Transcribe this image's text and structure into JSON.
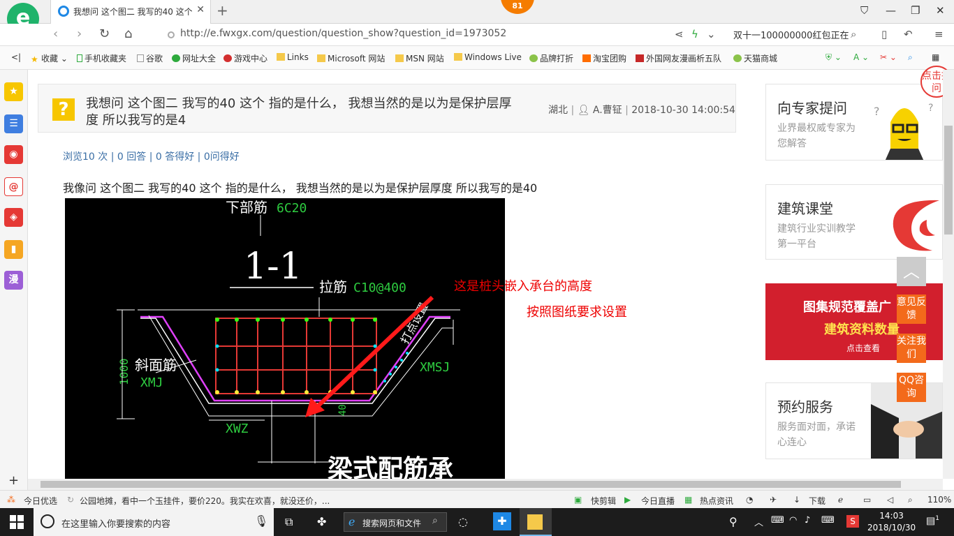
{
  "browser": {
    "tab_title": "我想问 这个图二 我写的40 这个 指的是什么",
    "badge": "81",
    "url": "http://e.fwxgx.com/question/question_show?question_id=1973052",
    "search_text": "双十一100000000红包正在"
  },
  "bookmarks": [
    "收藏",
    "手机收藏夹",
    "谷歌",
    "网址大全",
    "游戏中心",
    "Links",
    "Microsoft 网站",
    "MSN 网站",
    "Windows Live",
    "品牌打折",
    "淘宝团购",
    "外国网友漫画析五队",
    "天猫商城"
  ],
  "sidebar": {
    "comic_label": "漫"
  },
  "question": {
    "icon": "?",
    "title": "我想问 这个图二 我写的40 这个 指的是什么， 我想当然的是以为是保护层厚度 所以我写的是4",
    "location": "湖北",
    "author": "A.曹钲",
    "time": "2018-10-30 14:00:54",
    "stats": "浏览10 次 | 0 回答 | 0 答得好 | 0问得好",
    "body": "我像问  这个图二 我写的40 这个  指的是什么，  我想当然的是以为是保护层厚度 所以我写的是40"
  },
  "drawing": {
    "bottom_bar": "下部筋",
    "bottom_bar_spec": "6C20",
    "section": "1-1",
    "tie_bar": "拉筋",
    "tie_bar_spec": "C10@400",
    "slope_bar": "斜面筋",
    "xmj": "XMJ",
    "xmsj": "XMSJ",
    "xwz": "XWZ",
    "dim_1000": "1000",
    "dim_40": "40",
    "side_label": "打点设置",
    "bottom_text": "梁式配筋承",
    "annotation_1": "这是桩头嵌入承台的高度",
    "annotation_2": "按照图纸要求设置"
  },
  "right_cards": [
    {
      "title": "向专家提问",
      "subtitle": "业界最权威专家为您解答"
    },
    {
      "title": "建筑课堂",
      "subtitle": "建筑行业实训教学第一平台"
    },
    {
      "title": "预约服务",
      "subtitle": "服务面对面，承诺心连心"
    }
  ],
  "promo": {
    "line1": "图集规范覆盖广",
    "line2": "建筑资料数量",
    "button": "点击查看"
  },
  "floats": {
    "feedback": "意见反馈",
    "follow": "关注我们",
    "qq": "QQ咨询",
    "corner_ad": "点击提问"
  },
  "statusbar": {
    "today": "今日优选",
    "news": "公园地摊，看中一个玉挂件，要价220。我实在欢喜，就没还价，...",
    "kuaijian": "快剪辑",
    "live": "今日直播",
    "hot": "热点资讯",
    "download": "下载",
    "zoom": "110%"
  },
  "taskbar": {
    "search_placeholder": "在这里输入你要搜索的内容",
    "ie_search": "搜索网页和文件",
    "time": "14:03",
    "date": "2018/10/30",
    "notification_count": "1"
  }
}
